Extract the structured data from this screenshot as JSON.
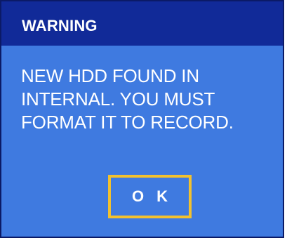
{
  "dialog": {
    "title": "WARNING",
    "message": "NEW HDD FOUND IN\nINTERNAL.  YOU MUST\nFORMAT IT TO RECORD.",
    "ok_label": "O K"
  },
  "colors": {
    "title_bar": "#112a98",
    "dialog_background": "#3f7ae0",
    "border": "#0b1a66",
    "button_focus_border": "#f2c12e",
    "text": "#ffffff"
  }
}
